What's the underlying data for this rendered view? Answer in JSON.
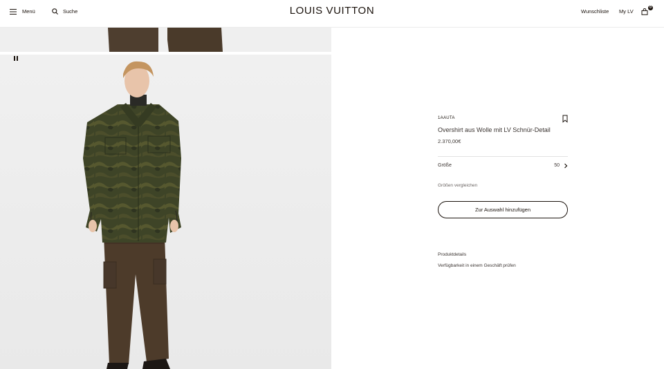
{
  "header": {
    "menu_label": "Menü",
    "search_label": "Suche",
    "brand": "LOUIS VUITTON",
    "wishlist_label": "Wunschliste",
    "account_label": "My LV",
    "cart_count": "0"
  },
  "product": {
    "sku": "1AAUTA",
    "name": "Overshirt aus Wolle mit LV Schnür-Detail",
    "price": "2.370,00€",
    "size_label": "Größe",
    "size_value": "50",
    "compare_sizes_label": "Größen vergleichen",
    "add_to_selection_label": "Zur Auswahl hinzufügen",
    "details_label": "Produktdetails",
    "availability_label": "Verfügbarkeit in einem Geschäft prüfen"
  },
  "colors": {
    "text": "#19110b",
    "jacket": "#3f4526",
    "trousers": "#4a3a2a"
  },
  "icons": [
    "menu-icon",
    "search-icon",
    "shopping-bag-icon",
    "pause-icon",
    "bookmark-icon",
    "chevron-right-icon"
  ]
}
